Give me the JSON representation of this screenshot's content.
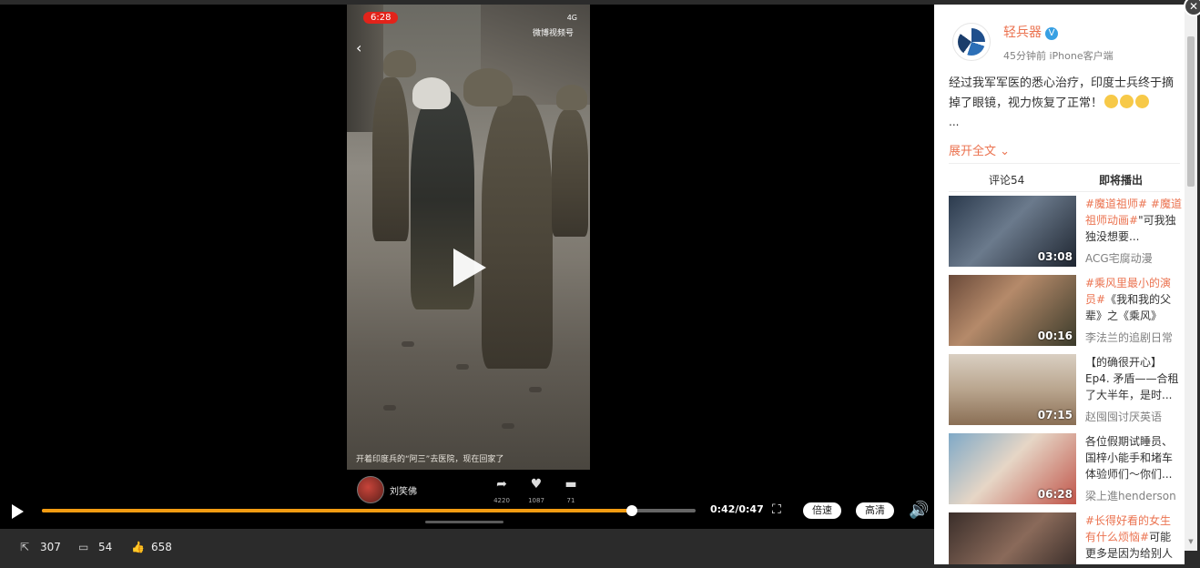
{
  "video": {
    "phone_time": "6:28",
    "phone_status": "4G",
    "watermark": "微博视频号",
    "caption": "开着印度兵的“阿三”去医院，现在回家了",
    "author_name": "刘笑佛",
    "share_count": "4220",
    "like_count": "1087",
    "comment_count": "71"
  },
  "controls": {
    "current_time": "0:42",
    "duration": "0:47",
    "time_display": "0:42/0:47",
    "progress_fraction": 0.903,
    "speed_label": "倍速",
    "quality_label": "高清"
  },
  "bottom_bar": {
    "share_count": "307",
    "comment_count": "54",
    "like_count": "658"
  },
  "sidebar": {
    "account_name": "轻兵器",
    "meta": "45分钟前 iPhone客户端",
    "post_text": "经过我军军医的悉心治疗，印度士兵终于摘掉了眼镜，视力恢复了正常！",
    "ellipsis": "...",
    "expand_label": "展开全文",
    "tabs": [
      "评论54",
      "即将播出"
    ],
    "recommendations": [
      {
        "tags": "#魔道祖师# #魔道祖师动画#",
        "title": "\"可我独独没想要...",
        "author": "ACG宅腐动漫",
        "duration": "03:08"
      },
      {
        "tags": "#乘风里最小的演员#",
        "title": "《我和我的父辈》之《乘风》篇...",
        "author": "李法兰的追剧日常",
        "duration": "00:16"
      },
      {
        "tags": "",
        "title": "【的确很开心】Ep4. 矛盾——合租了大半年，是时...",
        "author": "赵囤囤讨厌英语",
        "duration": "07:15"
      },
      {
        "tags": "",
        "title": "各位假期试睡员、国梓小能手和堵车体验师们～你们...",
        "author": "梁上進henderson",
        "duration": "06:28"
      },
      {
        "tags": "#长得好看的女生有什么烦恼#",
        "title": "可能更多是因为给别人带...",
        "author": "",
        "duration": ""
      }
    ]
  },
  "icons": {
    "close": "close-icon",
    "play": "play-icon",
    "fullscreen": "fullscreen-icon",
    "volume": "volume-icon",
    "share": "share-icon",
    "comment": "comment-icon",
    "like": "like-icon"
  }
}
